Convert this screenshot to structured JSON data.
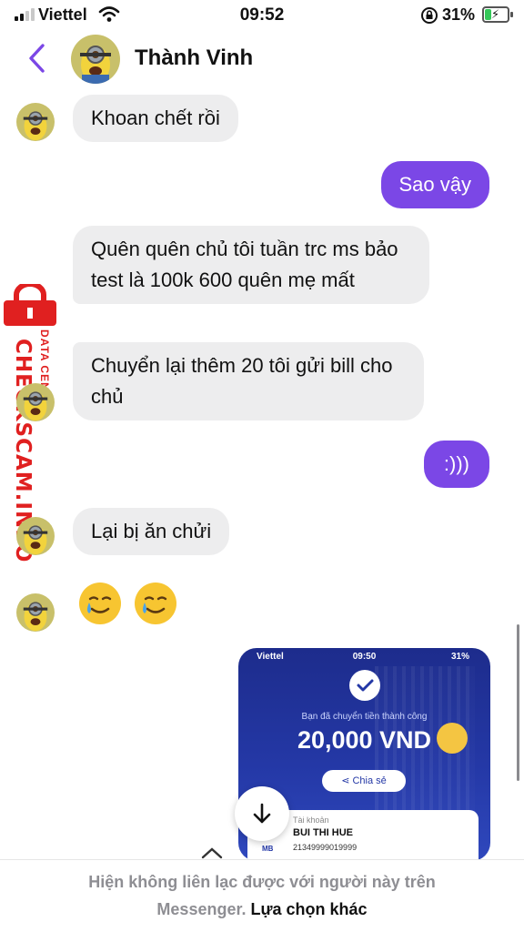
{
  "status_bar": {
    "carrier": "Viettel",
    "time": "09:52",
    "battery_percent": "31%",
    "battery_level": 0.31,
    "icons": [
      "signal-icon",
      "wifi-icon",
      "orientation-lock-icon",
      "battery-charging-icon"
    ]
  },
  "header": {
    "contact_name": "Thành Vinh",
    "back_icon": "chevron-left-icon",
    "accent_color": "#7b47e6"
  },
  "messages": [
    {
      "side": "in",
      "text": "Khoan chết rồi"
    },
    {
      "side": "out",
      "text": "Sao vậy"
    },
    {
      "side": "in",
      "text": "Quên quên chủ tôi tuần trc ms bảo test là 100k 600 quên mẹ mất"
    },
    {
      "side": "in",
      "text": "Chuyển lại thêm 20 tôi gửi bill cho chủ"
    },
    {
      "side": "out",
      "text": ":)))"
    },
    {
      "side": "in",
      "text": "Lại bị ăn chửi"
    },
    {
      "side": "in",
      "emoji": [
        "🥲",
        "🥲"
      ]
    }
  ],
  "watermark": {
    "big": "CHECKSCAM.INFO",
    "small": "DATA CENTER"
  },
  "attachment": {
    "carrier": "Viettel",
    "time": "09:50",
    "battery": "31%",
    "message": "Bạn đã chuyển tiền thành công",
    "amount": "20,000 VND",
    "share_label": "Chia sẻ",
    "account_label": "Tài khoản",
    "recipient_name": "BUI THI HUE",
    "account_number": "21349999019999",
    "bank": "MB"
  },
  "footer": {
    "line1": "Hiện không liên lạc được với người này trên",
    "line2_prefix": "Messenger.",
    "other_options": "Lựa chọn khác"
  }
}
